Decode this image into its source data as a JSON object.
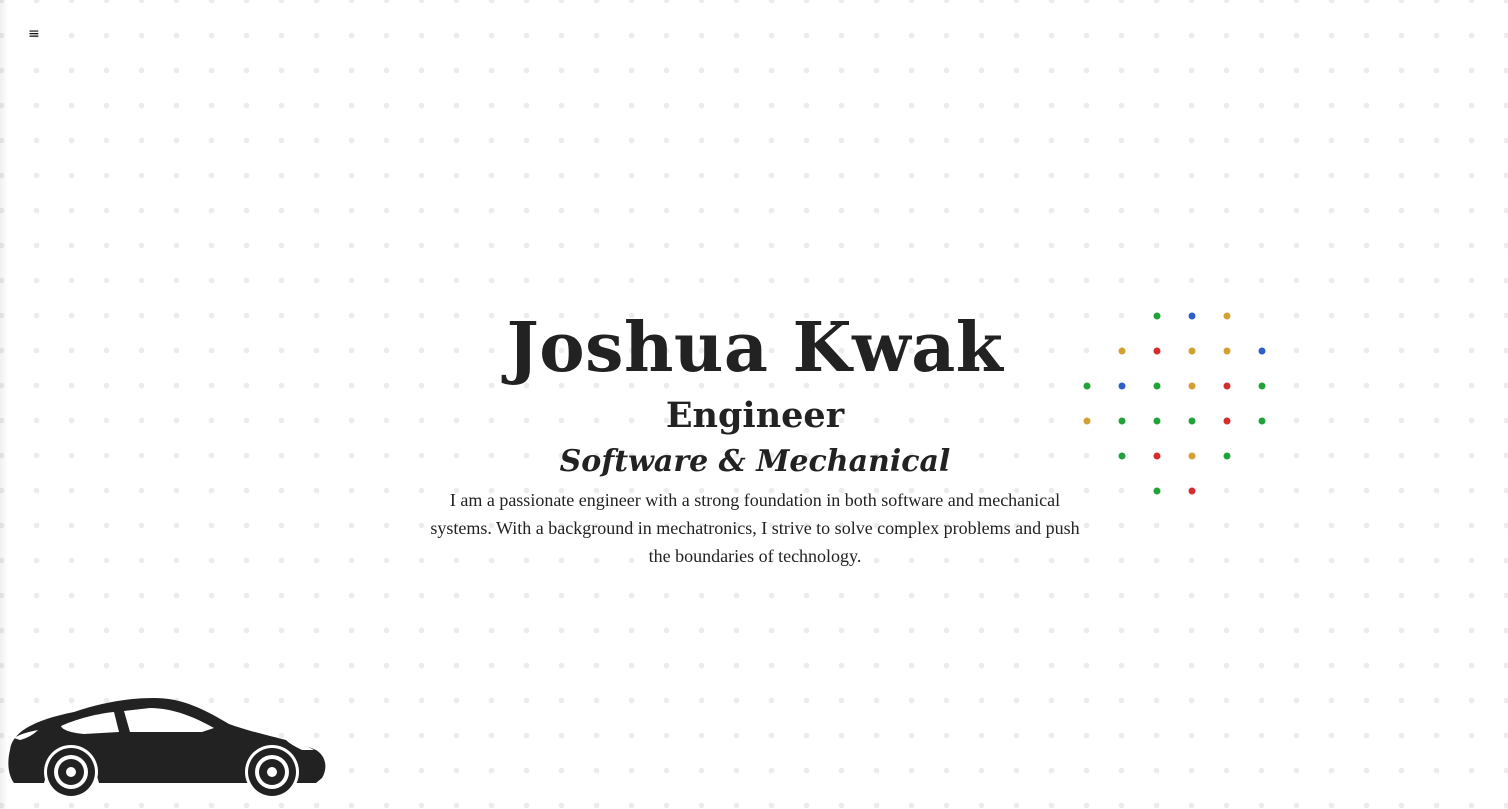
{
  "nav": {
    "menu_icon": "hamburger-menu-icon",
    "menu_glyph": "≡"
  },
  "hero": {
    "name": "Joshua Kwak",
    "role": "Engineer",
    "subtitle": "Software & Mechanical",
    "description": "I am a passionate engineer with a strong foundation in both software and mechanical systems. With a background in mechatronics, I strive to solve complex problems and push the boundaries of technology."
  },
  "decoration": {
    "dot_colors": {
      "green": "#22a33a",
      "blue": "#2d5ec9",
      "gold": "#d4a032",
      "red": "#d62c2c"
    },
    "car_icon": "car-silhouette-icon",
    "car_color": "#222222"
  }
}
